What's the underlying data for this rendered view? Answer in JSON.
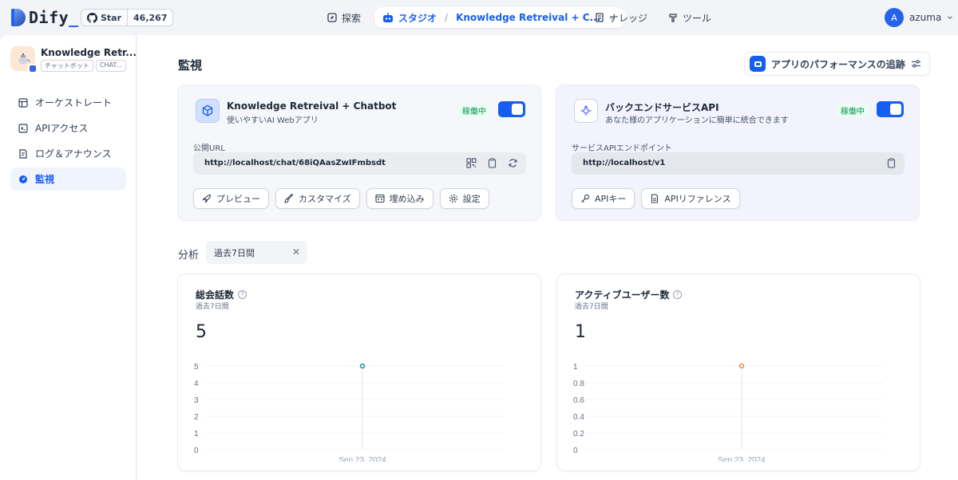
{
  "header": {
    "logo_text": "Dify",
    "logo_suffix": "_",
    "github": {
      "star_label": "Star",
      "count": "46,267"
    },
    "nav": {
      "explore": "探索",
      "studio": "スタジオ",
      "studio_app": "Knowledge Retreival + C...",
      "knowledge": "ナレッジ",
      "tools": "ツール"
    },
    "user": {
      "initial": "A",
      "name": "azuma"
    }
  },
  "sidebar": {
    "app_name": "Knowledge Retr...",
    "tags": [
      "チャットボット",
      "CHAT..."
    ],
    "items": [
      {
        "label": "オーケストレート",
        "icon": "orchestrate-icon"
      },
      {
        "label": "APIアクセス",
        "icon": "terminal-icon"
      },
      {
        "label": "ログ＆アナウンス",
        "icon": "file-list-icon"
      },
      {
        "label": "監視",
        "icon": "dashboard-icon",
        "active": true
      }
    ]
  },
  "main": {
    "title": "監視",
    "perf_button": "アプリのパフォーマンスの追跡",
    "webapp_card": {
      "title": "Knowledge Retreival + Chatbot",
      "subtitle": "使いやすいAI Webアプリ",
      "status": "稼働中",
      "url_label": "公開URL",
      "url": "http://localhost/chat/68iQAasZwIFmbsdt",
      "buttons": [
        "プレビュー",
        "カスタマイズ",
        "埋め込み",
        "設定"
      ]
    },
    "api_card": {
      "title": "バックエンドサービスAPI",
      "subtitle": "あなた様のアプリケーションに簡単に統合できます",
      "status": "稼働中",
      "url_label": "サービスAPIエンドポイント",
      "url": "http://localhost/v1",
      "buttons": [
        "APIキー",
        "APIリファレンス"
      ]
    },
    "analysis_label": "分析",
    "period_select": "過去7日間"
  },
  "chart_data": [
    {
      "type": "line",
      "title": "総会話数",
      "subtitle": "過去7日間",
      "summary_value": "5",
      "x": [
        "Sep 23, 2024"
      ],
      "series": [
        {
          "values": [
            5
          ]
        }
      ],
      "yticks": [
        "0",
        "1",
        "2",
        "3",
        "4",
        "5"
      ],
      "ylim": [
        0,
        5
      ],
      "color": "#1f8fa6"
    },
    {
      "type": "line",
      "title": "アクティブユーザー数",
      "subtitle": "過去7日間",
      "summary_value": "1",
      "x": [
        "Sep 23, 2024"
      ],
      "series": [
        {
          "values": [
            1
          ]
        }
      ],
      "yticks": [
        "0",
        "0.2",
        "0.4",
        "0.6",
        "0.8",
        "1"
      ],
      "ylim": [
        0,
        1
      ],
      "color": "#f0883a"
    }
  ]
}
